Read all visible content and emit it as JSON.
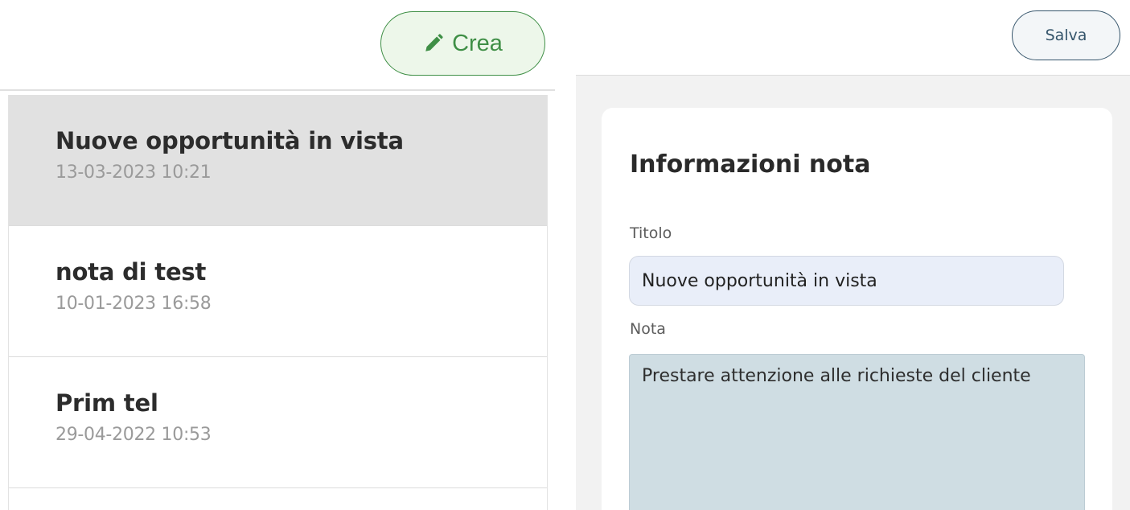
{
  "toolbar": {
    "create_label": "Crea",
    "create_icon": "pencil-icon",
    "save_label": "Salva"
  },
  "notes": [
    {
      "title": "Nuove opportunità in vista",
      "date": "13-03-2023 10:21",
      "selected": true
    },
    {
      "title": "nota di test",
      "date": "10-01-2023 16:58",
      "selected": false
    },
    {
      "title": "Prim tel",
      "date": "29-04-2022 10:53",
      "selected": false
    }
  ],
  "detail": {
    "heading": "Informazioni nota",
    "title_label": "Titolo",
    "title_value": "Nuove opportunità in vista",
    "note_label": "Nota",
    "note_value": "Prestare attenzione alle richieste del cliente"
  },
  "colors": {
    "accent_green": "#3f8f46",
    "accent_blue": "#35556b",
    "selected_row": "#e1e1e1",
    "input_bg": "#e9eef9",
    "textarea_bg": "#cfdde3"
  }
}
